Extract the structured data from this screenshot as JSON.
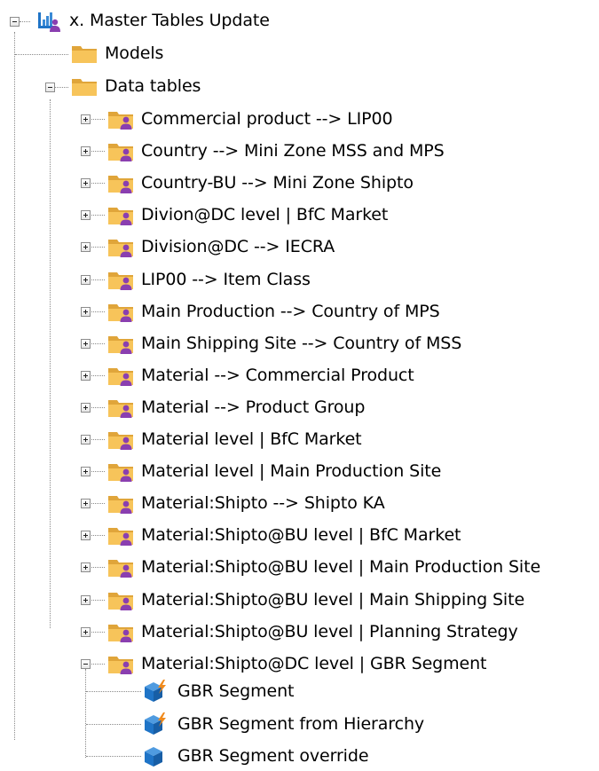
{
  "tree": {
    "root": {
      "label": "x. Master Tables Update",
      "icon": "master-tables-icon",
      "expanded": true
    },
    "models": {
      "label": "Models",
      "icon": "folder-icon"
    },
    "data_tables": {
      "label": "Data tables",
      "icon": "folder-icon",
      "expanded": true
    },
    "tables": [
      {
        "label": "Commercial product --> LIP00",
        "icon": "user-folder-icon",
        "expanded": false
      },
      {
        "label": "Country --> Mini Zone MSS and MPS",
        "icon": "user-folder-icon",
        "expanded": false
      },
      {
        "label": "Country-BU --> Mini Zone Shipto",
        "icon": "user-folder-icon",
        "expanded": false
      },
      {
        "label": "Divion@DC level | BfC Market",
        "icon": "user-folder-icon",
        "expanded": false
      },
      {
        "label": "Division@DC --> IECRA",
        "icon": "user-folder-icon",
        "expanded": false
      },
      {
        "label": "LIP00 --> Item Class",
        "icon": "user-folder-icon",
        "expanded": false
      },
      {
        "label": "Main Production --> Country of MPS",
        "icon": "user-folder-icon",
        "expanded": false
      },
      {
        "label": "Main Shipping Site --> Country of MSS",
        "icon": "user-folder-icon",
        "expanded": false
      },
      {
        "label": "Material --> Commercial Product",
        "icon": "user-folder-icon",
        "expanded": false
      },
      {
        "label": "Material --> Product Group",
        "icon": "user-folder-icon",
        "expanded": false
      },
      {
        "label": "Material level | BfC Market",
        "icon": "user-folder-icon",
        "expanded": false
      },
      {
        "label": "Material level | Main Production Site",
        "icon": "user-folder-icon",
        "expanded": false
      },
      {
        "label": "Material:Shipto --> Shipto KA",
        "icon": "user-folder-icon",
        "expanded": false
      },
      {
        "label": "Material:Shipto@BU level | BfC Market",
        "icon": "user-folder-icon",
        "expanded": false
      },
      {
        "label": "Material:Shipto@BU level | Main Production Site",
        "icon": "user-folder-icon",
        "expanded": false
      },
      {
        "label": "Material:Shipto@BU level | Main Shipping Site",
        "icon": "user-folder-icon",
        "expanded": false
      },
      {
        "label": "Material:Shipto@BU level | Planning Strategy",
        "icon": "user-folder-icon",
        "expanded": false
      },
      {
        "label": "Material:Shipto@DC level | GBR Segment",
        "icon": "user-folder-icon",
        "expanded": true
      }
    ],
    "segment_children": [
      {
        "label": "GBR Segment",
        "icon": "cube-lightning-icon"
      },
      {
        "label": "GBR Segment from Hierarchy",
        "icon": "cube-lightning-icon"
      },
      {
        "label": "GBR Segment override",
        "icon": "cube-icon"
      }
    ]
  },
  "colors": {
    "folder": "#f7c45a",
    "folder_dark": "#e0a53a",
    "user": "#8a3fb0",
    "cube": "#1f74c7",
    "lightning": "#f08a1c",
    "tree_line": "#8a8a8a"
  }
}
